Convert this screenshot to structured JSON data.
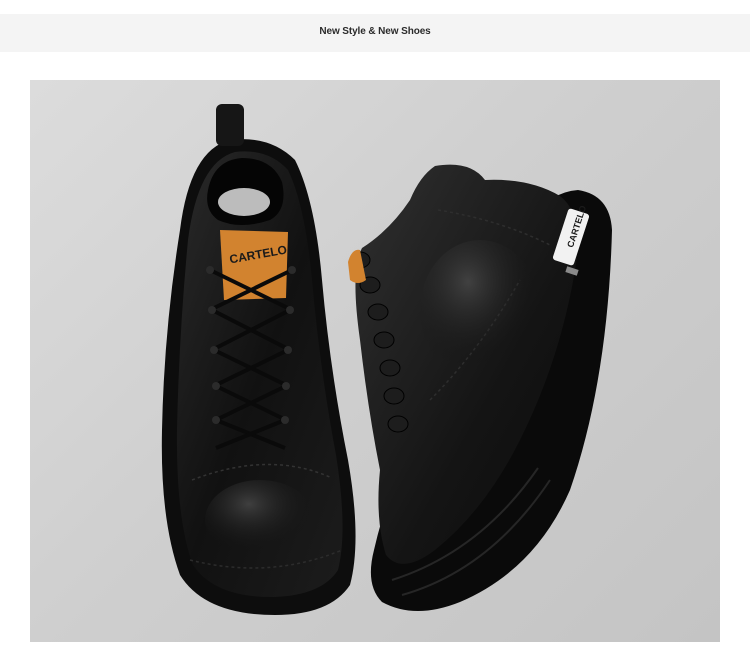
{
  "header": {
    "title": "New Style & New Shoes"
  },
  "product_image": {
    "brand_tag_left": "CARTELO",
    "brand_tag_right": "CARTELO",
    "shoe_color": "#121212",
    "background_color": "#cfcfcf",
    "tag_color": "#d2832f"
  }
}
